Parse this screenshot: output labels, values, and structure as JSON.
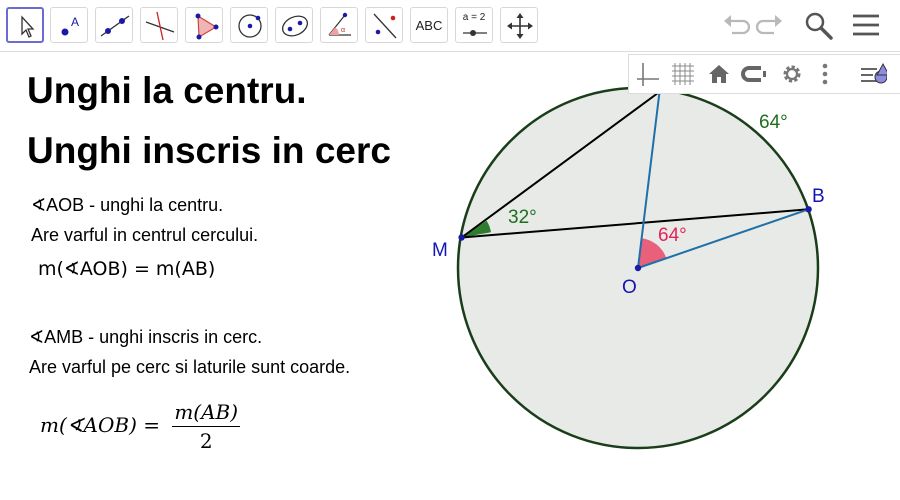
{
  "toolbar": {
    "tools": [
      {
        "icon": "move-arrow-icon",
        "active": true
      },
      {
        "icon": "point-icon",
        "point_label": "A"
      },
      {
        "icon": "line-icon"
      },
      {
        "icon": "perpendicular-line-icon"
      },
      {
        "icon": "polygon-icon"
      },
      {
        "icon": "circle-center-point-icon"
      },
      {
        "icon": "conic-ellipse-icon"
      },
      {
        "icon": "angle-icon"
      },
      {
        "icon": "reflect-about-line-icon"
      },
      {
        "icon": "text-icon",
        "label": "ABC"
      },
      {
        "icon": "slider-icon",
        "label": "a = 2"
      },
      {
        "icon": "move-graphics-view-icon"
      }
    ],
    "right": [
      "undo-icon",
      "redo-icon",
      "search-icon",
      "menu-icon"
    ]
  },
  "stylebar": {
    "buttons": [
      "axes-toggle-icon",
      "grid-toggle-icon",
      "home-icon",
      "point-capturing-icon",
      "settings-gear-icon",
      "more-options-icon",
      "style-bar-toggle-icon"
    ]
  },
  "text_panel": {
    "title_line1": "Unghi la centru.",
    "title_line2": "Unghi inscris in cerc",
    "central_angle_def": "∢AOB - unghi la centru.",
    "central_angle_note": "Are varful in centrul cercului.",
    "formula_central": "m(∢AOB) = m(AB)",
    "inscribed_angle_def": "∢AMB - unghi inscris in cerc.",
    "inscribed_angle_note": "Are varful pe cerc si laturile sunt coarde.",
    "formula_inscribed_lhs": "m(∢AOB) =",
    "formula_inscribed_num": "m(AB)",
    "formula_inscribed_den": "2"
  },
  "figure": {
    "labels": {
      "M": "M",
      "B": "B",
      "O": "O"
    },
    "arc_measure": "64°",
    "inscribed_angle_value": "32°",
    "central_angle_value": "64°",
    "colors": {
      "circle_stroke": "#1a3d1a",
      "circle_fill": "#e7eae6",
      "point": "#1a1aa8",
      "label": "#1414b4",
      "radius": "#1f6fa8",
      "chord": "#000000",
      "inscribed_angle": "#1e6e1e",
      "central_angle": "#e03a5c"
    }
  }
}
